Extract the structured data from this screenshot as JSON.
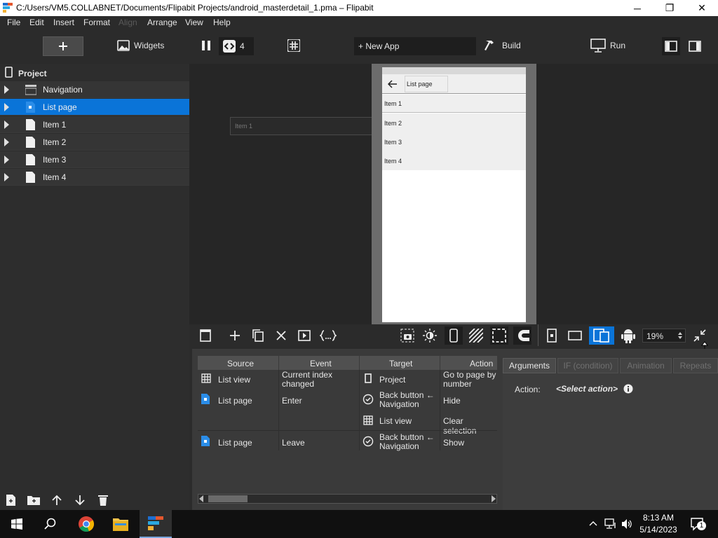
{
  "window": {
    "title": "C:/Users/VM5.COLLABNET/Documents/Flipabit Projects/android_masterdetail_1.pma – Flipabit"
  },
  "menu": [
    "File",
    "Edit",
    "Insert",
    "Format",
    "Align",
    "Arrange",
    "View",
    "Help"
  ],
  "toolbar": {
    "widgets_label": "Widgets",
    "code_count": "4",
    "new_app_label": "+ New App",
    "build_label": "Build",
    "run_label": "Run"
  },
  "tree": {
    "header": "Project",
    "items": [
      {
        "label": "Navigation",
        "icon": "navigation-icon"
      },
      {
        "label": "List page",
        "icon": "page-icon",
        "selected": true
      },
      {
        "label": "Item 1",
        "icon": "page-icon"
      },
      {
        "label": "Item 2",
        "icon": "page-icon"
      },
      {
        "label": "Item 3",
        "icon": "page-icon"
      },
      {
        "label": "Item 4",
        "icon": "page-icon"
      }
    ]
  },
  "canvas": {
    "offscreen_item": "Item 1",
    "phone": {
      "header_title": "List page",
      "items": [
        "Item 1",
        "Item 2",
        "Item 3",
        "Item 4"
      ]
    }
  },
  "zoom": "19%",
  "events": {
    "columns": [
      "Source",
      "Event",
      "Target",
      "Action"
    ],
    "rows": [
      {
        "source": "List view",
        "source_icon": "grid-icon",
        "event": "Current index changed",
        "target": "Project",
        "target_icon": "phone-icon",
        "action": "Go to page by number"
      },
      {
        "source": "List page",
        "source_icon": "page-icon",
        "event": "Enter",
        "target": "Back button ← Navigation",
        "target_icon": "check-circle-icon",
        "action": "Hide"
      },
      {
        "source": "",
        "source_icon": "",
        "event": "",
        "target": "List view",
        "target_icon": "grid-icon",
        "action": "Clear selection"
      },
      {
        "source": "List page",
        "source_icon": "page-icon",
        "event": "Leave",
        "target": "Back button ← Navigation",
        "target_icon": "check-circle-icon",
        "action": "Show"
      }
    ]
  },
  "props": {
    "tabs": [
      "Arguments",
      "IF (condition)",
      "Animation",
      "Repeats"
    ],
    "action_label": "Action:",
    "action_value": "<Select action>"
  },
  "taskbar": {
    "time": "8:13 AM",
    "date": "5/14/2023",
    "notif_count": "1"
  },
  "colors": {
    "accent": "#0a74d8",
    "bg": "#2b2b2b"
  }
}
